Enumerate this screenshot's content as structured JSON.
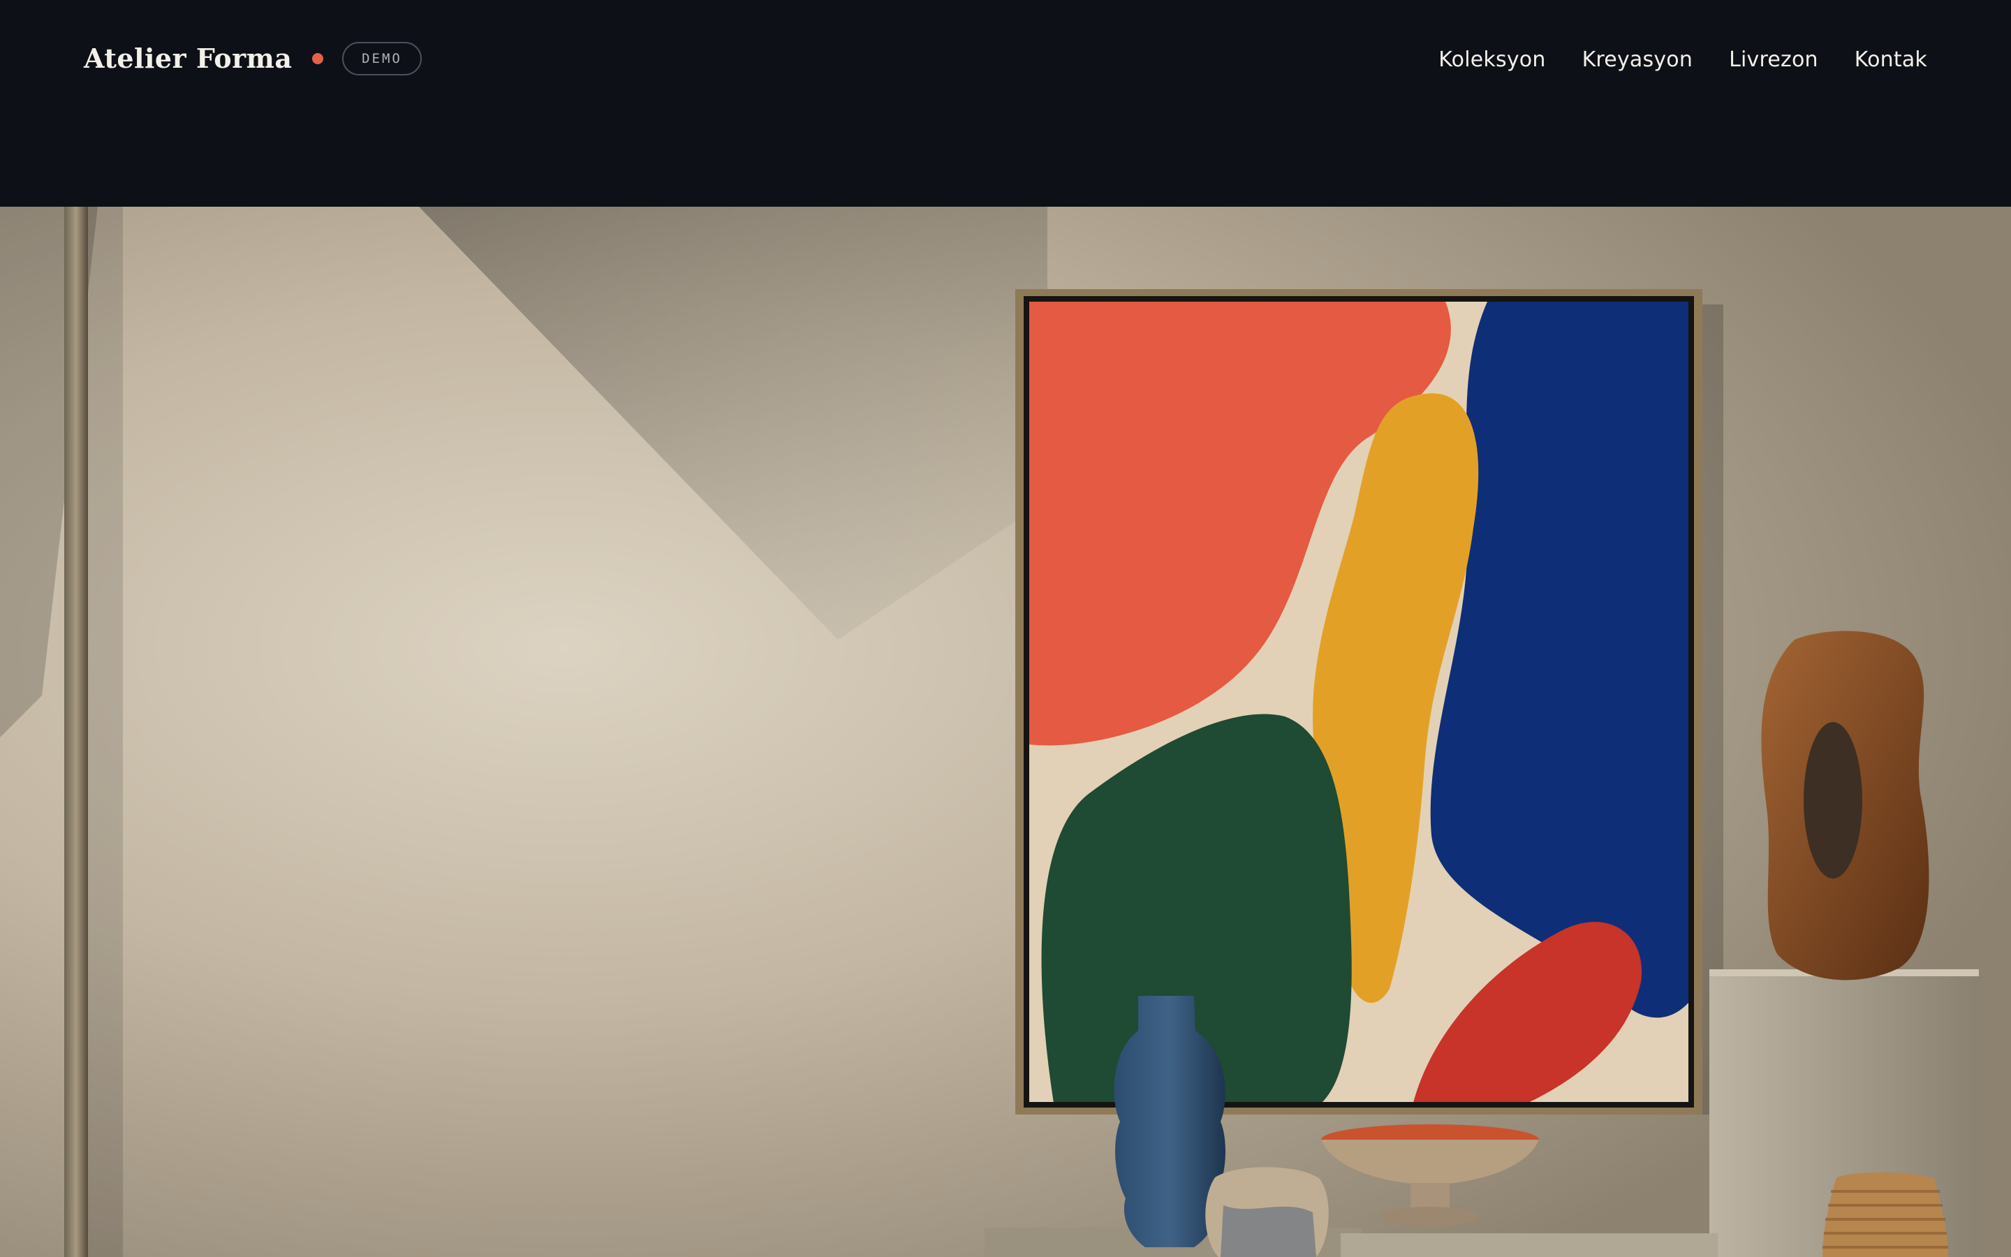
{
  "header": {
    "brand": "Atelier Forma",
    "badge": "DEMO",
    "nav": [
      {
        "label": "Koleksyon"
      },
      {
        "label": "Kreyasyon"
      },
      {
        "label": "Livrezon"
      },
      {
        "label": "Kontak"
      }
    ]
  },
  "colors": {
    "header_bg": "#0d1016",
    "accent_dot": "#e8604a",
    "painting_coral": "#e55a42",
    "painting_yellow": "#e2a126",
    "painting_blue": "#0f2e78",
    "painting_green": "#1f4a33",
    "painting_red": "#c8332a"
  },
  "hero": {
    "image_subject": "still-life-interior"
  }
}
